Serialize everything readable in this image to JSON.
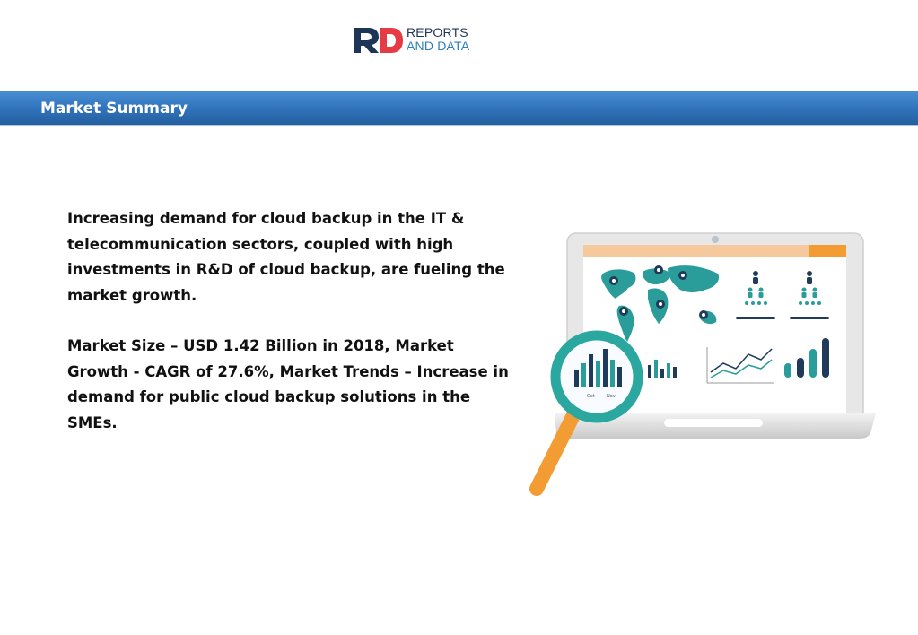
{
  "logo": {
    "line1": "REPORTS",
    "line2": "AND DATA"
  },
  "banner": {
    "title": "Market Summary"
  },
  "content": {
    "paragraph1": "Increasing demand for cloud backup in the IT & telecommunication sectors, coupled with high investments in R&D of cloud backup, are fueling the market growth.",
    "paragraph2": "Market Size – USD 1.42 Billion in 2018, Market Growth - CAGR of 27.6%, Market Trends – Increase in demand for public cloud backup solutions in the SMEs."
  },
  "illustration": {
    "lens_labels": [
      "Oct",
      "Nov"
    ],
    "colors": {
      "teal": "#2a9d9a",
      "navy": "#1f3a5a",
      "orange": "#f39c33"
    }
  }
}
